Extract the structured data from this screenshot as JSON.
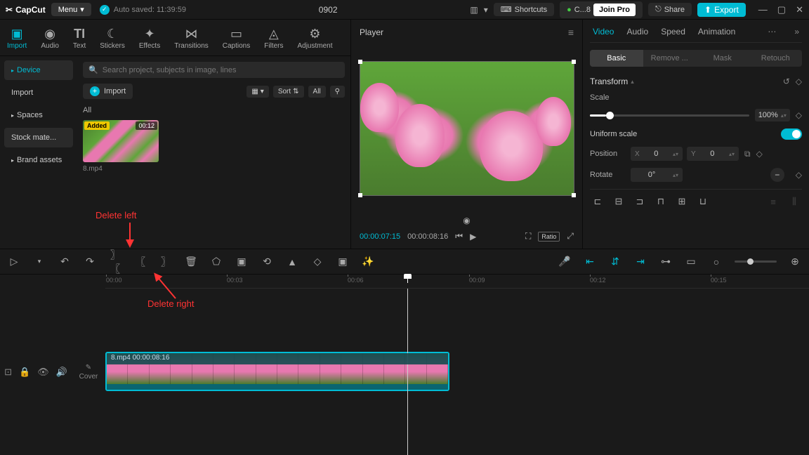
{
  "titlebar": {
    "logo_text": "CapCut",
    "menu": "Menu",
    "autosave": "Auto saved: 11:39:59",
    "project": "0902",
    "shortcuts": "Shortcuts",
    "credits": "C...8",
    "join_pro": "Join Pro",
    "share": "Share",
    "export": "Export"
  },
  "tool_tabs": [
    "Import",
    "Audio",
    "Text",
    "Stickers",
    "Effects",
    "Transitions",
    "Captions",
    "Filters",
    "Adjustment"
  ],
  "left_sidebar": {
    "items": [
      "Device",
      "Import",
      "Spaces",
      "Stock mate...",
      "Brand assets"
    ]
  },
  "search": {
    "placeholder": "Search project, subjects in image, lines"
  },
  "import_chip": "Import",
  "sort_label": "Sort",
  "all_label": "All",
  "all_header": "All",
  "clip": {
    "badge": "Added",
    "duration": "00:12",
    "name": "8.mp4"
  },
  "player": {
    "title": "Player",
    "time_current": "00:00:07:15",
    "time_total": "00:00:08:16",
    "ratio": "Ratio"
  },
  "props": {
    "tabs": [
      "Video",
      "Audio",
      "Speed",
      "Animation"
    ],
    "subtabs": [
      "Basic",
      "Remove ...",
      "Mask",
      "Retouch"
    ],
    "transform": "Transform",
    "scale_label": "Scale",
    "scale_value": "100%",
    "uniform": "Uniform scale",
    "position_label": "Position",
    "pos_x_label": "X",
    "pos_x": "0",
    "pos_y_label": "Y",
    "pos_y": "0",
    "rotate_label": "Rotate",
    "rotate_value": "0°"
  },
  "timeline": {
    "ticks": [
      "00:00",
      "00:03",
      "00:06",
      "00:09",
      "00:12",
      "00:15"
    ],
    "clip_label": "8.mp4   00:00:08:16",
    "cover": "Cover"
  },
  "annotations": {
    "delete_left": "Delete left",
    "delete_right": "Delete right"
  }
}
